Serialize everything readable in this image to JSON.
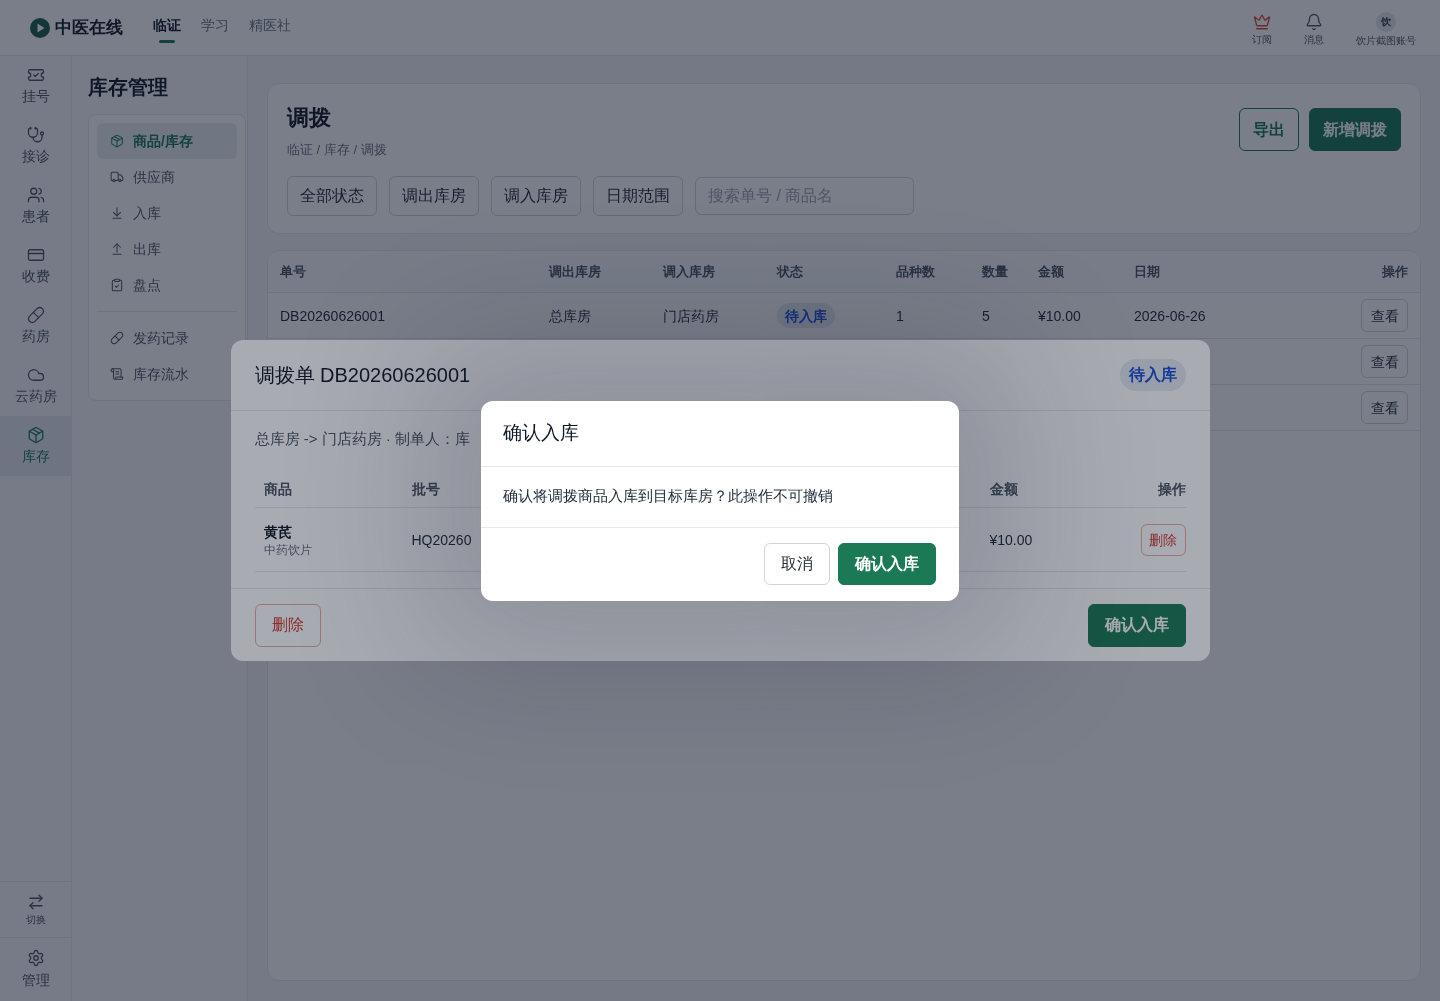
{
  "top_bar": {
    "logo_text": "中医在线",
    "nav_tabs": [
      {
        "label": "临证",
        "selected": true
      },
      {
        "label": "学习",
        "selected": false
      },
      {
        "label": "精医社",
        "selected": false
      }
    ],
    "actions": [
      {
        "kind": "subscribe",
        "label": "订阅"
      },
      {
        "kind": "messages",
        "label": "消息"
      }
    ],
    "account": {
      "avatar_text": "饮",
      "name": "饮片截图账号"
    }
  },
  "rail": {
    "items": [
      {
        "kind": "registration",
        "label": "挂号",
        "selected": false
      },
      {
        "kind": "consultation",
        "label": "接诊",
        "selected": false
      },
      {
        "kind": "patients",
        "label": "患者",
        "selected": false
      },
      {
        "kind": "billing",
        "label": "收费",
        "selected": false
      },
      {
        "kind": "pharmacy",
        "label": "药房",
        "selected": false
      },
      {
        "kind": "cloud",
        "label": "云药房",
        "selected": false
      },
      {
        "kind": "inventory",
        "label": "库存",
        "selected": true
      }
    ],
    "bottom_items": [
      {
        "kind": "switch",
        "label": "切换"
      },
      {
        "kind": "settings",
        "label": "管理"
      }
    ]
  },
  "sub_nav": {
    "title": "库存管理",
    "sections": [
      {
        "items": [
          {
            "kind": "goods",
            "label": "商品/库存",
            "selected": true
          },
          {
            "kind": "supplier",
            "label": "供应商",
            "selected": false
          },
          {
            "kind": "inbound",
            "label": "入库",
            "selected": false
          },
          {
            "kind": "outbound",
            "label": "出库",
            "selected": false
          },
          {
            "kind": "stocktake",
            "label": "盘点",
            "selected": false
          }
        ]
      },
      {
        "items": [
          {
            "kind": "dispensing",
            "label": "发药记录",
            "selected": false
          },
          {
            "kind": "ledger",
            "label": "库存流水",
            "selected": false
          }
        ]
      }
    ]
  },
  "page_header": {
    "title": "调拨",
    "breadcrumb": "临证 / 库存 / 调拨",
    "buttons": [
      {
        "kind": "outline",
        "label": "导出"
      },
      {
        "kind": "primary",
        "label": "新增调拨"
      }
    ],
    "filters": [
      "全部状态",
      "调出库房",
      "调入库房",
      "日期范围"
    ],
    "search": {
      "placeholder": "搜索单号 / 商品名"
    }
  },
  "transfers_table": {
    "columns": [
      "单号",
      "调出库房",
      "调入库房",
      "状态",
      "品种数",
      "数量",
      "金额",
      "日期",
      "操作"
    ],
    "rows": [
      {
        "order_no": "DB20260626001",
        "from_store": "总库房",
        "to_store": "门店药房",
        "status": "待入库",
        "varieties": "1",
        "quantity": "5",
        "amount": "¥10.00",
        "date": "2026-06-26",
        "action": "查看"
      },
      {
        "action": "查看"
      },
      {
        "action": "查看"
      }
    ]
  },
  "transfer_dialog": {
    "title": "调拨单 DB20260626001",
    "status": "待入库",
    "summary": "总库房 -> 门店药房 · 制单人：库",
    "columns": [
      "商品",
      "批号",
      "金额",
      "操作"
    ],
    "rows": [
      {
        "name": "黄芪",
        "category": "中药饮片",
        "batch": "HQ20260",
        "amount": "¥10.00",
        "action": "删除"
      }
    ],
    "footer_buttons": [
      {
        "kind": "danger",
        "label": "删除"
      },
      {
        "kind": "primary",
        "label": "确认入库"
      }
    ]
  },
  "confirm_dialog": {
    "title": "确认入库",
    "message": "确认将调拨商品入库到目标库房？此操作不可撤销",
    "buttons": [
      {
        "kind": "secondary",
        "label": "取消"
      },
      {
        "kind": "primary",
        "label": "确认入库"
      }
    ]
  }
}
